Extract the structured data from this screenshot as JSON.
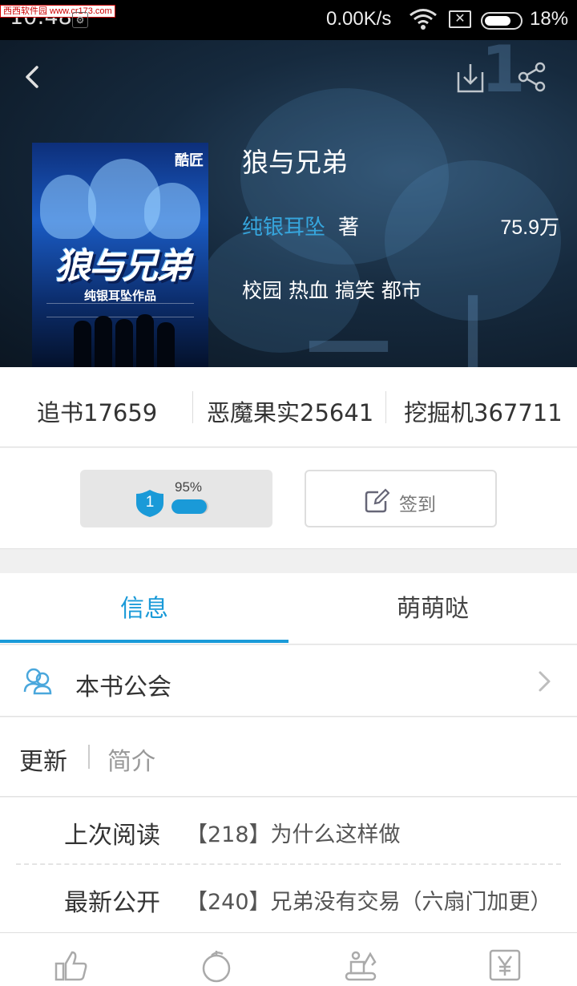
{
  "status_bar": {
    "time": "10:48",
    "watermark": "西西软件园 www.cr173.com",
    "net_speed": "0.00K/s",
    "sim_mark": "✕",
    "battery_percent": "18%",
    "battery_level": 0.18
  },
  "header": {
    "back_icon": "chevron-left-icon",
    "download_icon": "download-icon",
    "share_icon": "share-icon"
  },
  "book": {
    "cover": {
      "logo": "酷匠",
      "title": "狼与兄弟",
      "subtitle": "纯银耳坠作品"
    },
    "title": "狼与兄弟",
    "author": "纯银耳坠",
    "author_suffix": "著",
    "word_count": "75.9万",
    "tags": "校园 热血 搞笑 都市"
  },
  "stats": [
    {
      "label": "追书17659"
    },
    {
      "label": "恶魔果实25641"
    },
    {
      "label": "挖掘机367711"
    }
  ],
  "vip": {
    "level": "1",
    "progress_text": "95%",
    "progress": 0.95
  },
  "checkin": {
    "label": "签到"
  },
  "tabs": [
    {
      "label": "信息",
      "active": true
    },
    {
      "label": "萌萌哒",
      "active": false
    }
  ],
  "guild": {
    "label": "本书公会"
  },
  "subtabs": {
    "update": "更新",
    "intro": "简介"
  },
  "chapters": [
    {
      "label": "上次阅读",
      "value": "【218】为什么这样做"
    },
    {
      "label": "最新公开",
      "value": "【240】兄弟没有交易（六扇门加更）"
    }
  ],
  "bottom_bar": {
    "icons": [
      "thumbs-up-icon",
      "fruit-icon",
      "excavator-icon",
      "yuan-icon"
    ]
  },
  "colors": {
    "accent": "#1a9ad8",
    "author": "#36a5dc"
  }
}
